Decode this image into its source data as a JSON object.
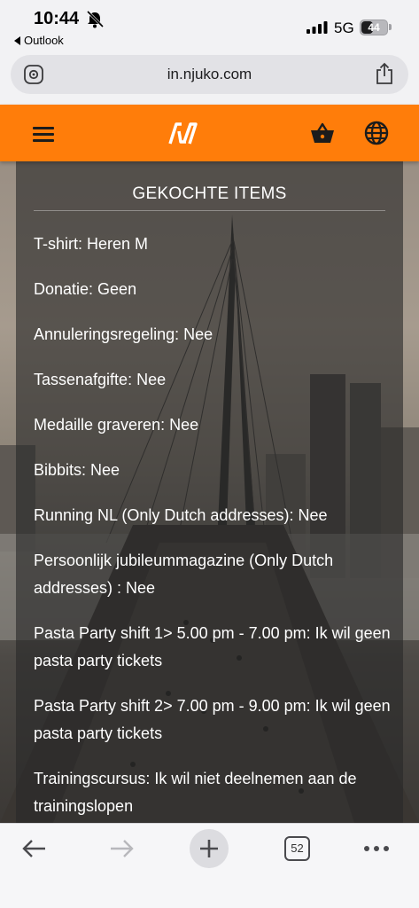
{
  "status_bar": {
    "time": "10:44",
    "back_app": "Outlook",
    "network": "5G",
    "battery": "44",
    "battery_level": 0.44
  },
  "browser": {
    "url": "in.njuko.com",
    "open_tabs": "52"
  },
  "site": {
    "brand_color": "#ff7d0a",
    "panel_title": "GEKOCHTE ITEMS",
    "items": [
      "T-shirt: Heren M",
      "Donatie: Geen",
      "Annuleringsregeling: Nee",
      "Tassenafgifte: Nee",
      "Medaille graveren: Nee",
      "Bibbits: Nee",
      "Running NL (Only Dutch addresses): Nee",
      "Persoonlijk jubileummagazine (Only Dutch addresses) : Nee",
      "Pasta Party shift 1> 5.00 pm - 7.00 pm: Ik wil geen pasta party tickets",
      "Pasta Party shift 2> 7.00 pm - 9.00 pm: Ik wil geen pasta party tickets",
      "Trainingscursus: Ik wil niet deelnemen aan de trainingslopen"
    ]
  },
  "icons": {
    "bell": "bell-slash-icon",
    "menu": "hamburger-menu-icon",
    "logo": "njuko-logo-icon",
    "cart": "basket-icon",
    "language": "globe-icon",
    "share": "share-icon",
    "site_settings": "page-settings-icon"
  }
}
